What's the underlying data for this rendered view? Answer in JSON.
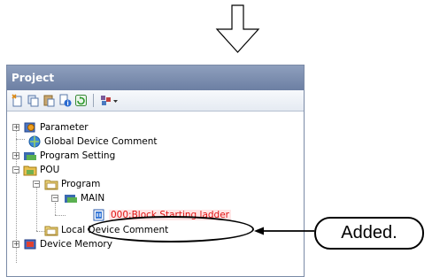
{
  "panel": {
    "title": "Project"
  },
  "toolbar": {
    "buttons": [
      "new-data-icon",
      "copy-icon",
      "paste-icon",
      "properties-icon",
      "refresh-icon",
      "sort-dropdown-icon"
    ]
  },
  "tree": {
    "parameter": "Parameter",
    "global_device_comment": "Global Device Comment",
    "program_setting": "Program Setting",
    "pou": "POU",
    "program": "Program",
    "main": "MAIN",
    "block": "000:Block Starting ladder",
    "local_device_comment": "Local Device Comment",
    "device_memory": "Device Memory"
  },
  "annotation": {
    "callout": "Added."
  },
  "colors": {
    "titlebar": "#7b8db0",
    "highlight_text": "#e01010",
    "callout_border": "#000000"
  }
}
